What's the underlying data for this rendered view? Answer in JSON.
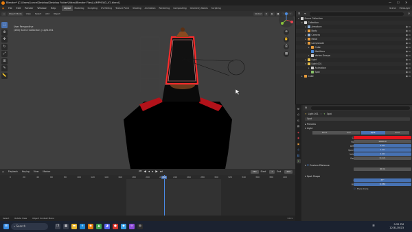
{
  "titlebar": {
    "title": "Blender* [C:\\Users\\Lance\\Desktop\\Desktop Folder\\Video\\Blender Files\\LAMPHEAD_V2.blend]",
    "min": "—",
    "max": "☐",
    "close": "✕"
  },
  "menu": {
    "items": [
      "File",
      "Edit",
      "Render",
      "Window",
      "Help"
    ],
    "workspaces": [
      "Layout",
      "Modeling",
      "Sculpting",
      "UV Editing",
      "Texture Paint",
      "Shading",
      "Animation",
      "Rendering",
      "Compositing",
      "Geometry Nodes",
      "Scripting"
    ],
    "active_workspace": "Layout",
    "scene": "Scene",
    "view_layer": "ViewLayer"
  },
  "viewport_header": {
    "mode": "Object Mode",
    "view": "View",
    "select": "Select",
    "add": "Add",
    "object": "Object",
    "orientation": "Global",
    "options": "Options"
  },
  "viewport": {
    "info_line1": "User Perspective",
    "info_line2": "(260) Scene Collection | Light.001"
  },
  "timeline": {
    "menus": [
      "Playback",
      "Keying",
      "View",
      "Marker"
    ],
    "current_frame": "260",
    "start_label": "Start",
    "start": "1",
    "end_label": "End",
    "end": "400",
    "ticks": [
      "0",
      "20",
      "40",
      "60",
      "80",
      "100",
      "120",
      "140",
      "160",
      "180",
      "200",
      "220",
      "240",
      "260",
      "280",
      "300",
      "320",
      "340",
      "360",
      "380",
      "400"
    ]
  },
  "statusbar": {
    "items": [
      "Select",
      "Rotate View",
      "Object Context Menu"
    ],
    "right": "3.6.1"
  },
  "outliner": {
    "search_placeholder": "",
    "rows": [
      {
        "indent": 0,
        "label": "Scene Collection",
        "icon": "#d7d7d7",
        "arrow": "▾"
      },
      {
        "indent": 1,
        "label": "Collection",
        "icon": "#d7d7d7",
        "arrow": "▾"
      },
      {
        "indent": 2,
        "label": "Armature",
        "icon": "#8fb0d8",
        "arrow": "▸"
      },
      {
        "indent": 2,
        "label": "Body",
        "icon": "#e89c3c",
        "arrow": "▸"
      },
      {
        "indent": 2,
        "label": "Camera",
        "icon": "#8fb0d8",
        "arrow": "▸"
      },
      {
        "indent": 2,
        "label": "Head",
        "icon": "#e89c3c",
        "arrow": "▸"
      },
      {
        "indent": 2,
        "label": "Lampshade",
        "icon": "#e89c3c",
        "arrow": "▾"
      },
      {
        "indent": 3,
        "label": "Cube",
        "icon": "#e89c3c",
        "arrow": "▸"
      },
      {
        "indent": 3,
        "label": "Modifiers",
        "icon": "#4d8de0",
        "arrow": ""
      },
      {
        "indent": 3,
        "label": "Vertex Groups",
        "icon": "#cfcfcf",
        "arrow": "▸"
      },
      {
        "indent": 2,
        "label": "Light",
        "icon": "#e8c04a",
        "arrow": "▸"
      },
      {
        "indent": 2,
        "label": "Light.001",
        "icon": "#e8c04a",
        "arrow": "▾"
      },
      {
        "indent": 3,
        "label": "Animation",
        "icon": "#cfcfcf",
        "arrow": "▸"
      },
      {
        "indent": 3,
        "label": "Spot",
        "icon": "#8ac46a",
        "arrow": ""
      },
      {
        "indent": 1,
        "label": "Cube",
        "icon": "#e89c3c",
        "arrow": "▸"
      }
    ]
  },
  "properties": {
    "object_name": "Light.001",
    "data_name": "Spot",
    "datablock": "Spot",
    "sections": {
      "preview": "Preview",
      "light": "Light",
      "custom_distance": "Custom Distance",
      "spot_shape": "Spot Shape"
    },
    "light_types": [
      "Point",
      "Sun",
      "Spot",
      "Area"
    ],
    "active_light_type": "Spot",
    "fields": [
      {
        "label": "Color",
        "value": "",
        "kind": "color"
      },
      {
        "label": "Power",
        "value": "1000 W",
        "kind": "plain"
      },
      {
        "label": "Diffuse",
        "value": "1.00",
        "kind": "blue"
      },
      {
        "label": "Specular",
        "value": "1.00",
        "kind": "blue"
      },
      {
        "label": "Volume",
        "value": "1.00",
        "kind": "blue"
      },
      {
        "label": "Radius",
        "value": "0.1 m",
        "kind": "plain"
      }
    ],
    "distance_value": "40 m",
    "spot_fields": [
      {
        "label": "Size",
        "value": "45°",
        "kind": "blue"
      },
      {
        "label": "Blend",
        "value": "0.150",
        "kind": "blue"
      }
    ],
    "show_cone": "Show Cone",
    "color_value": "#e8141c"
  },
  "taskbar": {
    "search": "Search",
    "time": "9:52 PM",
    "date": "12/31/2023"
  },
  "colors": {
    "accent": "#4772b3",
    "light_color": "#e8141c"
  }
}
